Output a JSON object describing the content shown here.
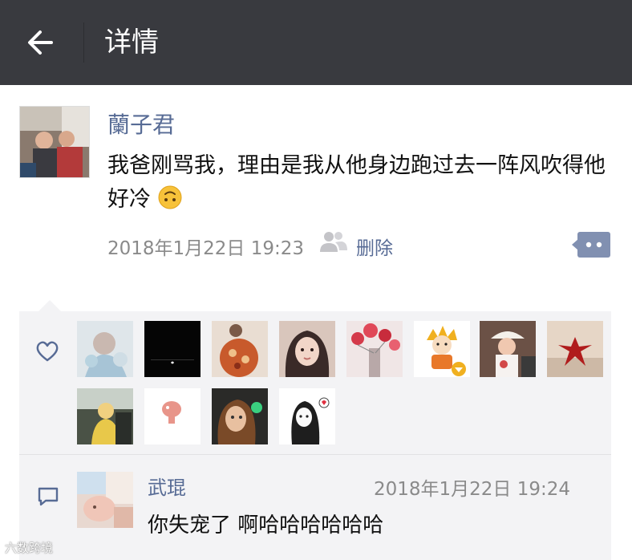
{
  "header": {
    "title": "详情"
  },
  "post": {
    "author": "蘭子君",
    "text": "我爸刚骂我，理由是我从他身边跑过去一阵风吹得他好冷",
    "timestamp": "2018年1月22日 19:23",
    "delete_label": "删除"
  },
  "likes": {
    "count_shown": 12
  },
  "comment": {
    "author": "武琨",
    "timestamp": "2018年1月22日 19:24",
    "text": "你失宠了 啊哈哈哈哈哈哈"
  },
  "watermark": "六数跨境",
  "colors": {
    "topbar": "#393a3f",
    "link": "#576b95",
    "panel": "#f3f3f5",
    "meta": "#8a8a8a"
  },
  "icons": [
    "back-arrow-icon",
    "friends-icon",
    "comment-bubble-icon",
    "heart-icon",
    "comment-icon",
    "upside-down-face-emoji"
  ]
}
